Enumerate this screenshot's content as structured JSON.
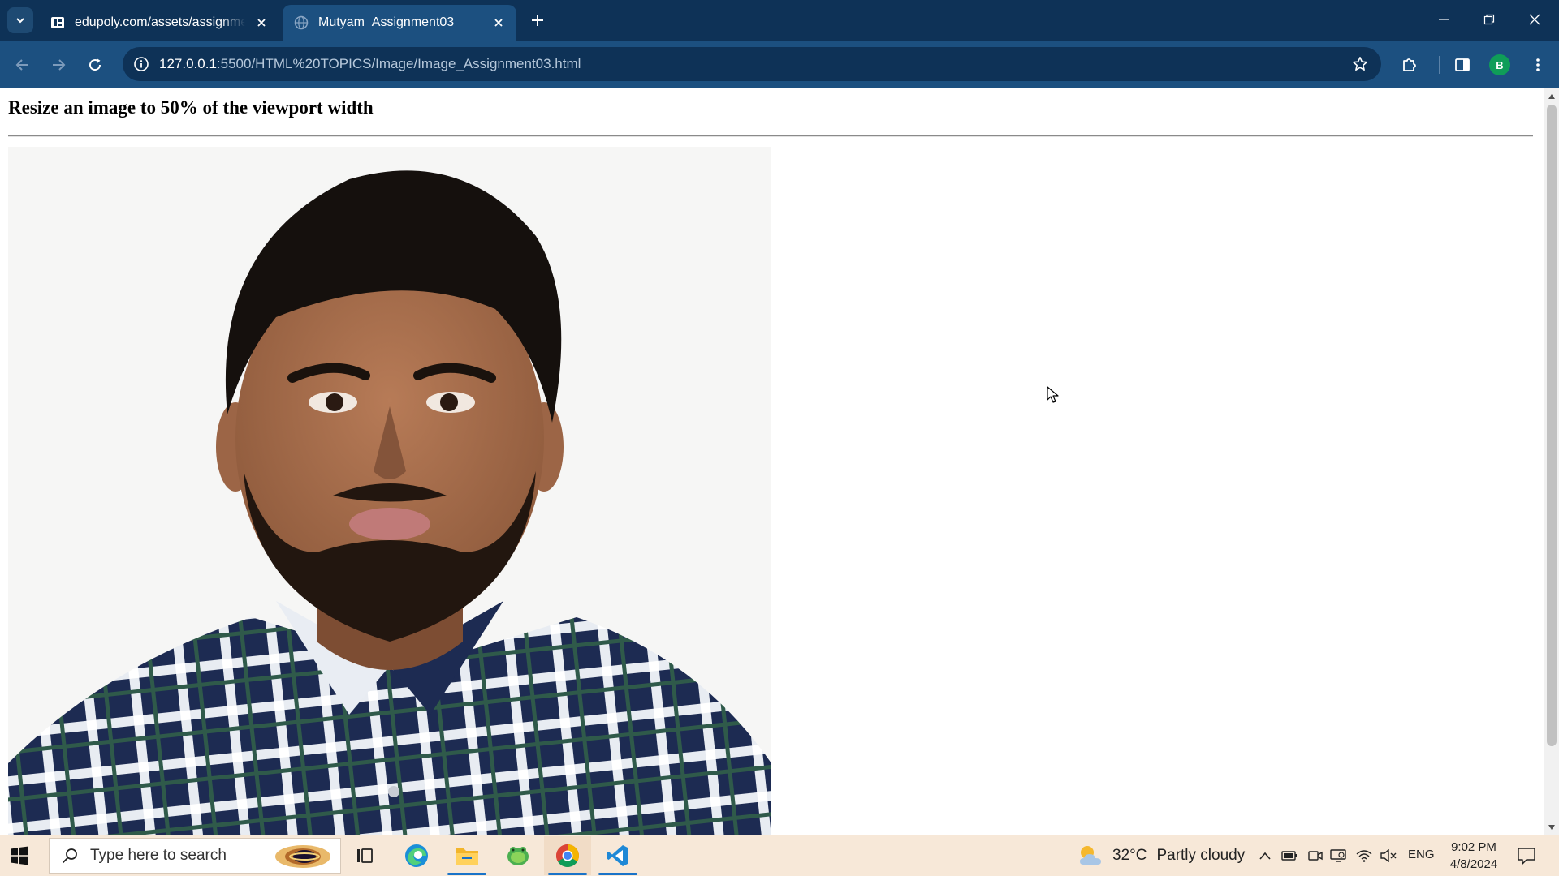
{
  "browser": {
    "tabs": [
      {
        "title": "edupoly.com/assets/assignmen",
        "active": false
      },
      {
        "title": "Mutyam_Assignment03",
        "active": true
      }
    ],
    "url_host": "127.0.0.1",
    "url_rest": ":5500/HTML%20TOPICS/Image/Image_Assignment03.html",
    "profile_initial": "B"
  },
  "page": {
    "heading": "Resize an image to 50% of the viewport width",
    "image_description": "portrait photo of a young man with a beard wearing a navy blue plaid shirt"
  },
  "taskbar": {
    "search_placeholder": "Type here to search",
    "weather_temp": "32°C",
    "weather_condition": "Partly cloudy",
    "language": "ENG",
    "time": "9:02 PM",
    "date": "4/8/2024",
    "pinned_apps": [
      "task-view",
      "edge",
      "file-explorer",
      "frog-app",
      "chrome",
      "vscode"
    ]
  },
  "colors": {
    "titlebar": "#0e3257",
    "toolbar": "#1c5080",
    "taskbar": "#f7e8d8",
    "accent": "#1a73c8"
  }
}
